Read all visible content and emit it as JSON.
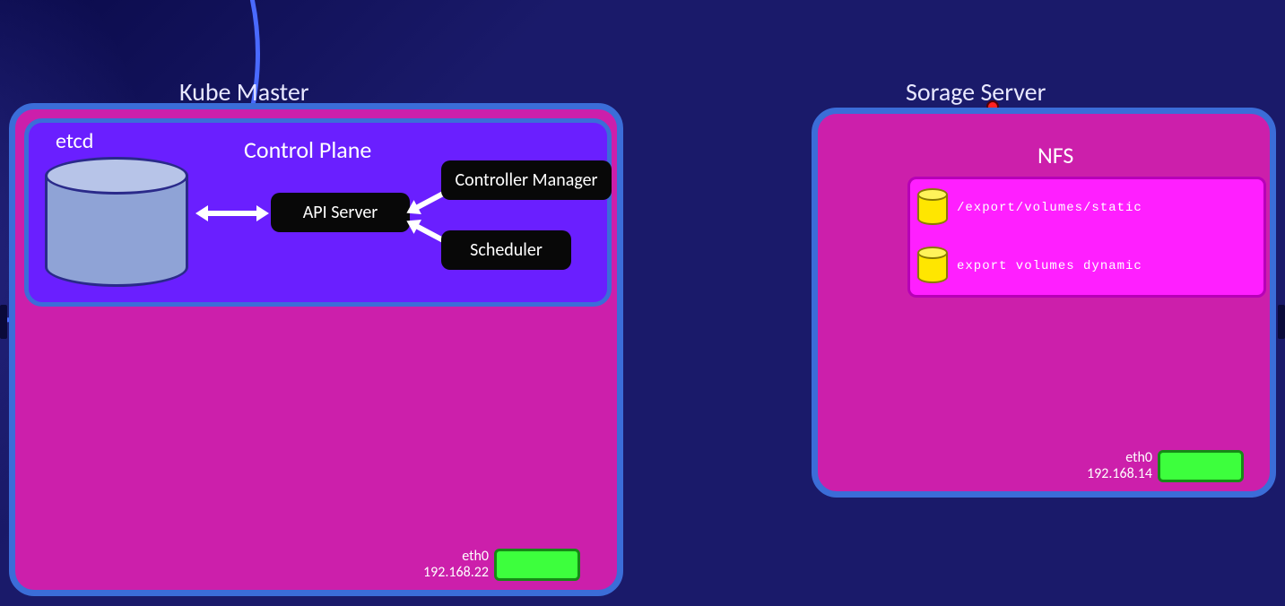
{
  "kube_master": {
    "title": "Kube Master",
    "etcd_label": "etcd",
    "control_plane": {
      "title": "Control Plane",
      "api_server": "API Server",
      "controller_manager": "Controller Manager",
      "scheduler": "Scheduler"
    },
    "nic": {
      "iface": "eth0",
      "ip": "192.168.22"
    }
  },
  "storage_server": {
    "title": "Sorage Server",
    "nfs": {
      "title": "NFS",
      "volumes": [
        {
          "path": "/export/volumes/static"
        },
        {
          "path": "export volumes dynamic"
        }
      ]
    },
    "nic": {
      "iface": "eth0",
      "ip": "192.168.14"
    }
  }
}
